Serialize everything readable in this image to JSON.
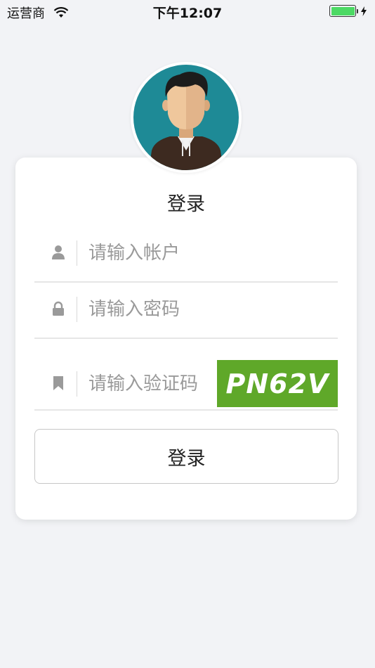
{
  "status_bar": {
    "carrier": "运营商",
    "time": "下午12:07",
    "battery_color": "#4cd964"
  },
  "avatar": {
    "icon": "user-avatar-illustration"
  },
  "card": {
    "title": "登录",
    "account": {
      "placeholder": "请输入帐户",
      "icon": "user-icon"
    },
    "password": {
      "placeholder": "请输入密码",
      "icon": "lock-icon"
    },
    "captcha": {
      "placeholder": "请输入验证码",
      "icon": "bookmark-icon",
      "code": "PN62V",
      "bg_color": "#5fa829"
    },
    "login_button": "登录"
  }
}
